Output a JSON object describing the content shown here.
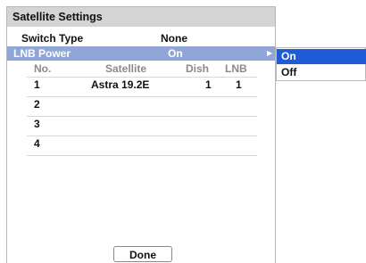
{
  "title": "Satellite Settings",
  "switch_type": {
    "label": "Switch Type",
    "value": "None"
  },
  "lnb_power": {
    "label": "LNB Power",
    "value": "On"
  },
  "table": {
    "headers": [
      "No.",
      "Satellite",
      "Dish",
      "LNB"
    ],
    "rows": [
      {
        "no": "1",
        "satellite": "Astra 19.2E",
        "dish": "1",
        "lnb": "1"
      },
      {
        "no": "2",
        "satellite": "",
        "dish": "",
        "lnb": ""
      },
      {
        "no": "3",
        "satellite": "",
        "dish": "",
        "lnb": ""
      },
      {
        "no": "4",
        "satellite": "",
        "dish": "",
        "lnb": ""
      }
    ]
  },
  "done_label": "Done",
  "popup": {
    "options": [
      "On",
      "Off"
    ],
    "selected": "On"
  },
  "colors": {
    "title_bar": "#d4d4d4",
    "highlight_row": "#90a6d6",
    "popup_selected": "#1f5bd7"
  },
  "icons": {
    "submenu_arrow": "triangle-right-icon"
  }
}
